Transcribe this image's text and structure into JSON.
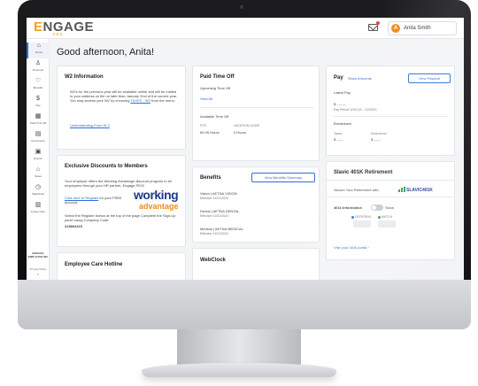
{
  "app": {
    "logo": "ENGAGE",
    "logo_sub": "PEO",
    "user_initial": "A",
    "user_name": "Anita Smith",
    "accent": "#2f6ed6",
    "brand_orange": "#f0a322"
  },
  "sidebar": {
    "items": [
      {
        "label": "Home",
        "icon": "home-icon",
        "glyph": "⌂"
      },
      {
        "label": "Personal",
        "icon": "person-icon",
        "glyph": "♙"
      },
      {
        "label": "Benefits",
        "icon": "benefits-icon",
        "glyph": "♡"
      },
      {
        "label": "Pay",
        "icon": "dollar-icon",
        "glyph": "$"
      },
      {
        "label": "Paid Time Off",
        "icon": "calendar-icon",
        "glyph": "▦"
      },
      {
        "label": "Documents",
        "icon": "document-icon",
        "glyph": "▤"
      },
      {
        "label": "Events",
        "icon": "events-icon",
        "glyph": "▣"
      },
      {
        "label": "Taxes",
        "icon": "bank-icon",
        "glyph": "⌂"
      },
      {
        "label": "WebClock",
        "icon": "clock-icon",
        "glyph": "◷"
      },
      {
        "label": "E-Rep Lists",
        "icon": "list-icon",
        "glyph": "▥"
      }
    ],
    "brand": "ENGAGE EMPLOYEE INC",
    "policy": "Privacy Policy",
    "copyright": "©"
  },
  "main": {
    "greeting": "Good afternoon, Anita!"
  },
  "w2": {
    "title": "W2 Information",
    "body": "W2's for the previous year will be available online and will be mailed to your address on file no later than January 31st of the current year. You may access your W2 by choosing",
    "link_taxes": "TAXES - W2",
    "from_menu": "from the menu.",
    "understanding": "Understanding Form W-2"
  },
  "discounts": {
    "title": "Exclusive Discounts to Members",
    "body": "Your employer offers the Working Advantage discount program to all employees through your HR partner, Engage PEO!",
    "register": "Click here to Register",
    "for_your": "for your FREE account.",
    "instructions": "Select the Register button at the top of the page Complete the Sign-Up panel using Company Code:",
    "code": "315804315",
    "logo_top": "working",
    "logo_bottom": "advantage"
  },
  "hotline": {
    "title": "Employee Care Hotline"
  },
  "pto": {
    "title": "Paid Time Off",
    "upcoming": "Upcoming Time Off",
    "view_all": "View All",
    "available": "Available Time Off",
    "col1_label": "PTO",
    "col1_value": "60.05 Hours",
    "col2_label": "VACATION LEAVE",
    "col2_value": "0 Hours"
  },
  "benefits": {
    "title": "Benefits",
    "button": "View Benefits Summary",
    "plans": [
      {
        "type": "Vision",
        "provider": "AETNA VISION",
        "effective": "Effective 01/01/2024"
      },
      {
        "type": "Dental",
        "provider": "AETNA DENTAL",
        "effective": "Effective 01/01/2024"
      },
      {
        "type": "Medical",
        "provider": "AETNA MEDICAL",
        "effective": "Effective 01/01/2024"
      }
    ]
  },
  "webclock": {
    "title": "WebClock"
  },
  "pay": {
    "title": "Pay",
    "show_amounts": "Show Amounts",
    "view_paystub": "View Paystub",
    "latest_pay": "Latest Pay",
    "latest_amount": "$ -.---.--",
    "pay_period": "Pay Period 12/01/23 - 12/15/23",
    "breakdown": "Breakdown",
    "taxes_label": "Taxes",
    "taxes_value": "$ ---.--",
    "deductions_label": "Deductions",
    "deductions_value": "$ ---.--"
  },
  "retirement": {
    "title": "Slavic 401K Retirement",
    "secure": "Secure Your Retirement with",
    "brand": "SLAVIC401K",
    "info_label": "401k Information",
    "show": "Show",
    "deferral": "DEFERRAL",
    "match": "MATCH",
    "deferral_color": "#2f6ed6",
    "match_color": "#2f9e4f",
    "portal": "Visit your 401k portal ›"
  }
}
